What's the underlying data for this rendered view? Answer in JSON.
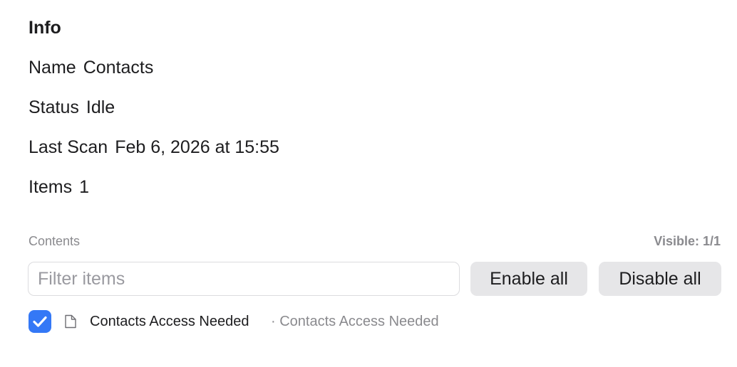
{
  "info": {
    "title": "Info",
    "name_label": "Name",
    "name_value": "Contacts",
    "status_label": "Status",
    "status_value": "Idle",
    "last_scan_label": "Last Scan",
    "last_scan_value": "Feb 6, 2026 at 15:55",
    "items_label": "Items",
    "items_value": "1"
  },
  "contents": {
    "header_label": "Contents",
    "visible_label": "Visible: 1/1",
    "filter_placeholder": "Filter items",
    "filter_value": "",
    "enable_all_label": "Enable all",
    "disable_all_label": "Disable all",
    "items": [
      {
        "checked": true,
        "icon": "document-icon",
        "title": "Contacts Access Needed",
        "subtitle": "· Contacts Access Needed"
      }
    ]
  },
  "colors": {
    "accent": "#3478f6",
    "secondary_text": "#8a8a8e",
    "button_bg": "#e6e6e8"
  }
}
